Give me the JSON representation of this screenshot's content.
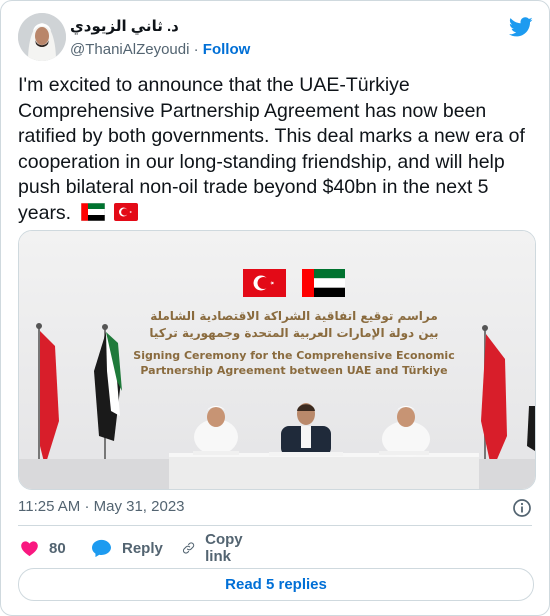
{
  "author": {
    "display_name": "د. ثاني الزيودي",
    "handle": "@ThaniAlZeyoudi",
    "separator": "·",
    "follow_label": "Follow"
  },
  "tweet": {
    "text": "I'm excited to announce that the UAE-Türkiye Comprehensive Partnership Agreement has now been ratified by both governments. This deal marks a new era of cooperation in our long-standing friendship, and will help push bilateral non-oil trade beyond $40bn in the next 5 years.",
    "emoji_flags": [
      "uae-flag",
      "turkey-flag"
    ]
  },
  "photo": {
    "banner_arabic_line1": "مراسم توقيع اتفاقية الشراكة الاقتصادية الشاملة",
    "banner_arabic_line2": "بين دولة الإمارات العربية المتحدة وجمهورية تركيا",
    "banner_english_line1": "Signing Ceremony for the Comprehensive Economic",
    "banner_english_line2": "Partnership Agreement between UAE and Türkiye"
  },
  "meta": {
    "time": "11:25 AM",
    "separator": "·",
    "date": "May 31, 2023"
  },
  "actions": {
    "likes": "80",
    "reply_label": "Reply",
    "copy_link_label": "Copy link"
  },
  "replies_button": "Read 5 replies",
  "colors": {
    "link": "#006fd6",
    "like": "#f91880",
    "reply": "#1d9bf0",
    "muted": "#536471"
  }
}
